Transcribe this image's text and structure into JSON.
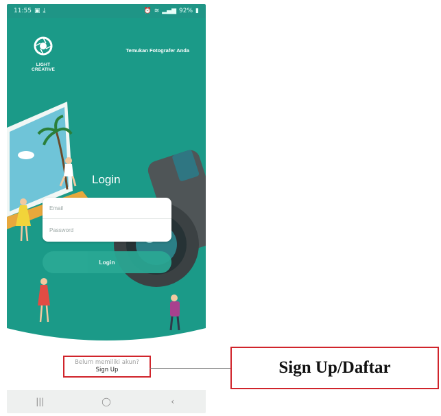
{
  "status_bar": {
    "time": "11:55",
    "battery": "92%"
  },
  "app": {
    "logo_text_line1": "LIGHT",
    "logo_text_line2": "CREATIVE",
    "tagline": "Temukan Fotografer Anda"
  },
  "login": {
    "title": "Login",
    "email_placeholder": "Email",
    "password_placeholder": "Password",
    "button_label": "Login"
  },
  "signup": {
    "question": "Belum memiliki akun?",
    "link_label": "Sign Up"
  },
  "nav": {
    "recents": "|||",
    "home": "◯",
    "back": "‹"
  },
  "annotation": {
    "callout_text": "Sign Up/Daftar"
  },
  "colors": {
    "brand_teal": "#1b9a88",
    "button_teal": "#2aa995",
    "highlight_red": "#d0242b"
  }
}
